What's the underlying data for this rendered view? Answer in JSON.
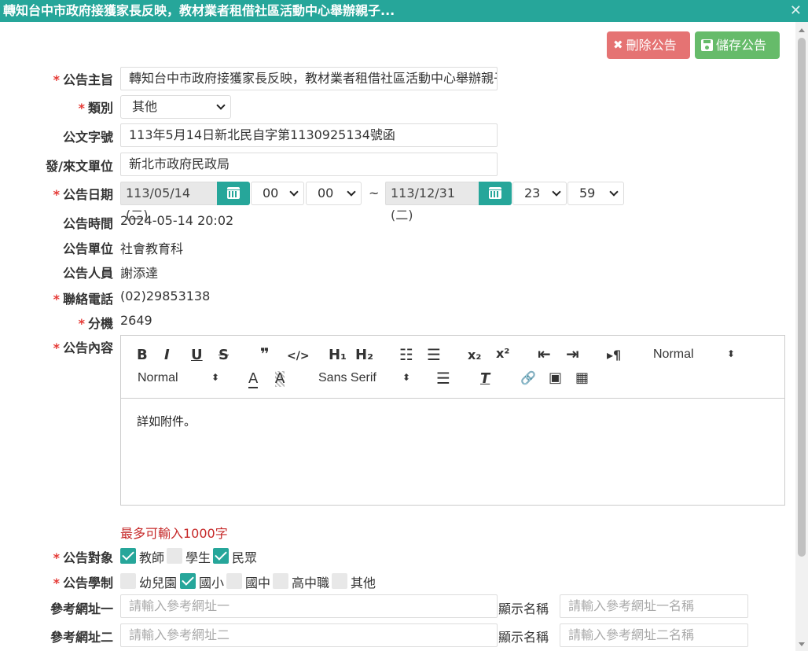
{
  "window": {
    "title": "轉知台中市政府接獲家長反映，教材業者租借社區活動中心舉辦親子...",
    "close_glyph": "✕"
  },
  "actions": {
    "delete_label": "刪除公告",
    "save_label": "儲存公告"
  },
  "form": {
    "subject": {
      "label": "公告主旨",
      "required": "*",
      "value": "轉知台中市政府接獲家長反映，教材業者租借社區活動中心舉辦親子"
    },
    "category": {
      "label": "類別",
      "required": "*",
      "value": "其他"
    },
    "doc_number": {
      "label": "公文字號",
      "value": "113年5月14日新北民自字第1130925134號函"
    },
    "issuer": {
      "label": "發/來文單位",
      "value": "新北市政府民政局"
    },
    "date": {
      "label": "公告日期",
      "required": "*",
      "start_date": "113/05/14 (二)",
      "start_hour": "00",
      "start_minute": "00",
      "separator": "~",
      "end_date": "113/12/31 (二)",
      "end_hour": "23",
      "end_minute": "59"
    },
    "time": {
      "label": "公告時間",
      "value": "2024-05-14 20:02"
    },
    "unit": {
      "label": "公告單位",
      "value": "社會教育科"
    },
    "person": {
      "label": "公告人員",
      "value": "謝添達"
    },
    "phone": {
      "label": "聯絡電話",
      "required": "*",
      "value": "(02)29853138"
    },
    "extension": {
      "label": "分機",
      "required": "*",
      "value": "2649"
    },
    "content": {
      "label": "公告內容",
      "required": "*",
      "toolbar": {
        "bold": "B",
        "italic": "I",
        "underline": "U",
        "strike": "S",
        "blockquote": "❞",
        "code": "</>",
        "h1": "H₁",
        "h2": "H₂",
        "ordered_list": "☷",
        "bullet_list": "☰",
        "subscript": "x₂",
        "superscript": "x²",
        "outdent": "⇤",
        "indent": "⇥",
        "direction": "▸¶",
        "header_select": "Normal",
        "size_select": "Normal",
        "font_color": "A",
        "bg_color": "A",
        "font_select": "Sans Serif",
        "align": "☰",
        "clear": "T",
        "link": "🔗",
        "image": "▣",
        "video": "▦",
        "updown": "⬍"
      },
      "body": "詳如附件。"
    },
    "content_hint": "最多可輸入1000字",
    "audience": {
      "label": "公告對象",
      "required": "*",
      "options": [
        {
          "label": "教師",
          "checked": true
        },
        {
          "label": "學生",
          "checked": false
        },
        {
          "label": "民眾",
          "checked": true
        }
      ]
    },
    "school_level": {
      "label": "公告學制",
      "required": "*",
      "options": [
        {
          "label": "幼兒園",
          "checked": false
        },
        {
          "label": "國小",
          "checked": true
        },
        {
          "label": "國中",
          "checked": false
        },
        {
          "label": "高中職",
          "checked": false
        },
        {
          "label": "其他",
          "checked": false
        }
      ]
    },
    "ref_url_1": {
      "label": "參考網址一",
      "placeholder": "請輸入參考網址一",
      "display_label": "顯示名稱",
      "display_placeholder": "請輸入參考網址一名稱"
    },
    "ref_url_2": {
      "label": "參考網址二",
      "placeholder": "請輸入參考網址二",
      "display_label": "顯示名稱",
      "display_placeholder": "請輸入參考網址二名稱"
    }
  }
}
